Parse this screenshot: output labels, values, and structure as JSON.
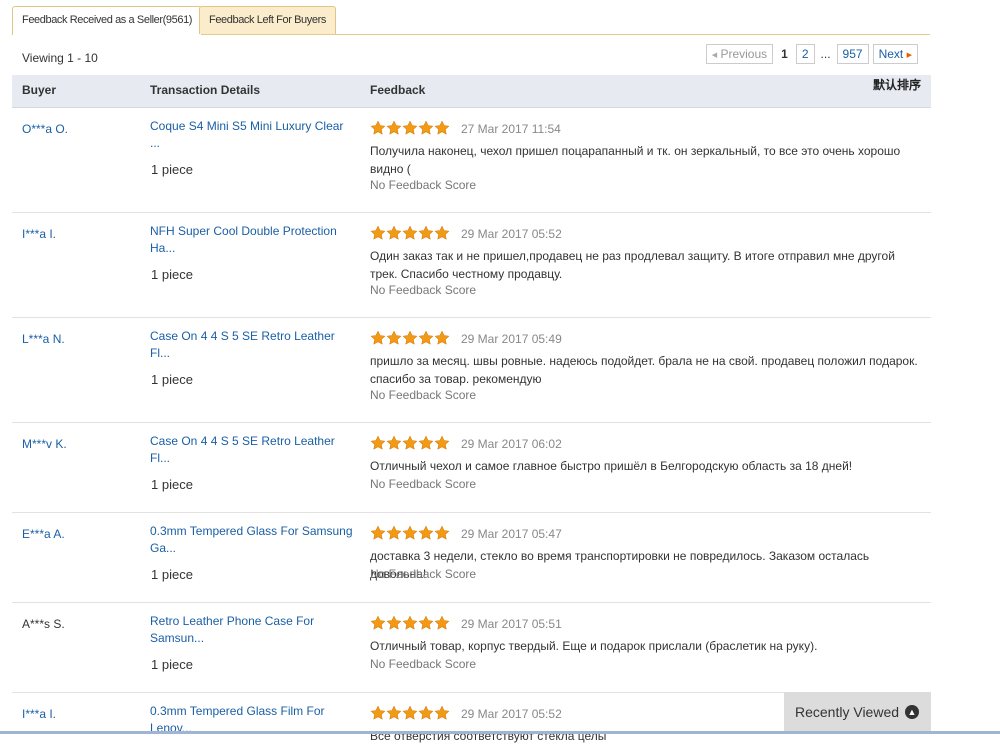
{
  "tabs": [
    {
      "label": "Feedback Received as a Seller(9561)",
      "active": true
    },
    {
      "label": "Feedback Left For Buyers",
      "active": false
    }
  ],
  "viewing": "Viewing 1 - 10",
  "pagination": {
    "previous": "Previous",
    "current": "1",
    "page2": "2",
    "ellipsis": "...",
    "last": "957",
    "next": "Next"
  },
  "table": {
    "headers": {
      "buyer": "Buyer",
      "transaction": "Transaction Details",
      "feedback": "Feedback"
    },
    "sort_label": "默认排序"
  },
  "rows": [
    {
      "buyer": "O***a O.",
      "product": "Coque S4 Mini S5 Mini Luxury Clear ...",
      "qty": "1 piece",
      "rating": 5,
      "date": "27 Mar 2017 11:54",
      "comment": "Получила наконец, чехол пришел поцарапанный и тк. он зеркальный, то все это очень хорошо видно (",
      "score": "No Feedback Score"
    },
    {
      "buyer": "I***a I.",
      "product": "NFH Super Cool Double Protection Ha...",
      "qty": "1 piece",
      "rating": 5,
      "date": "29 Mar 2017 05:52",
      "comment": "Один заказ так и не пришел,продавец не раз продлевал защиту. В итоге отправил мне другой трек. Спасибо честному продавцу.",
      "score": "No Feedback Score"
    },
    {
      "buyer": "L***a N.",
      "product": "Case On 4 4 S 5 SE Retro Leather Fl...",
      "qty": "1 piece",
      "rating": 5,
      "date": "29 Mar 2017 05:49",
      "comment": "пришло за месяц. швы ровные. надеюсь подойдет. брала не на свой. продавец положил подарок. спасибо за товар. рекомендую",
      "score": "No Feedback Score"
    },
    {
      "buyer": "M***v K.",
      "product": "Case On 4 4 S 5 SE Retro Leather Fl...",
      "qty": "1 piece",
      "rating": 5,
      "date": "29 Mar 2017 06:02",
      "comment": "Отличный чехол и самое главное быстро пришёл в Белгородскую область за 18 дней!",
      "score": "No Feedback Score"
    },
    {
      "buyer": "E***a A.",
      "product": "0.3mm Tempered Glass For Samsung Ga...",
      "qty": "1 piece",
      "rating": 5,
      "date": "29 Mar 2017 05:47",
      "comment": "доставка 3 недели, стекло во время транспортировки не повредилось. Заказом осталась довольна!",
      "score": "No Feedback Score"
    },
    {
      "buyer": "A***s S.",
      "product": "Retro Leather Phone Case For Samsun...",
      "qty": "1 piece",
      "rating": 5,
      "date": "29 Mar 2017 05:51",
      "comment": "Отличный товар, корпус твердый. Еще и подарок прислали (браслетик на руку).",
      "score": "No Feedback Score"
    },
    {
      "buyer": "I***a I.",
      "product": "0.3mm Tempered Glass Film For Lenov...",
      "qty": "",
      "rating": 5,
      "date": "29 Mar 2017 05:52",
      "comment": "Все отверстия соответствуют стекла целы",
      "score": ""
    }
  ],
  "recently_viewed": {
    "label": "Recently Viewed",
    "icon": "chevron-up-circle-icon"
  },
  "colors": {
    "link": "#1a5fa5",
    "star": "#f29a16",
    "header_bg": "#e7ebf1",
    "tab_bg": "#fbeccb"
  }
}
